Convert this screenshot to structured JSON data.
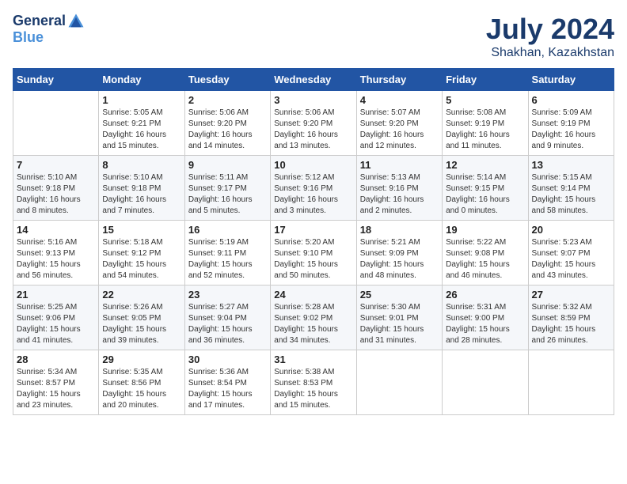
{
  "header": {
    "logo_line1": "General",
    "logo_line2": "Blue",
    "month": "July 2024",
    "location": "Shakhan, Kazakhstan"
  },
  "weekdays": [
    "Sunday",
    "Monday",
    "Tuesday",
    "Wednesday",
    "Thursday",
    "Friday",
    "Saturday"
  ],
  "weeks": [
    [
      {
        "day": "",
        "sunrise": "",
        "sunset": "",
        "daylight": ""
      },
      {
        "day": "1",
        "sunrise": "Sunrise: 5:05 AM",
        "sunset": "Sunset: 9:21 PM",
        "daylight": "Daylight: 16 hours and 15 minutes."
      },
      {
        "day": "2",
        "sunrise": "Sunrise: 5:06 AM",
        "sunset": "Sunset: 9:20 PM",
        "daylight": "Daylight: 16 hours and 14 minutes."
      },
      {
        "day": "3",
        "sunrise": "Sunrise: 5:06 AM",
        "sunset": "Sunset: 9:20 PM",
        "daylight": "Daylight: 16 hours and 13 minutes."
      },
      {
        "day": "4",
        "sunrise": "Sunrise: 5:07 AM",
        "sunset": "Sunset: 9:20 PM",
        "daylight": "Daylight: 16 hours and 12 minutes."
      },
      {
        "day": "5",
        "sunrise": "Sunrise: 5:08 AM",
        "sunset": "Sunset: 9:19 PM",
        "daylight": "Daylight: 16 hours and 11 minutes."
      },
      {
        "day": "6",
        "sunrise": "Sunrise: 5:09 AM",
        "sunset": "Sunset: 9:19 PM",
        "daylight": "Daylight: 16 hours and 9 minutes."
      }
    ],
    [
      {
        "day": "7",
        "sunrise": "Sunrise: 5:10 AM",
        "sunset": "Sunset: 9:18 PM",
        "daylight": "Daylight: 16 hours and 8 minutes."
      },
      {
        "day": "8",
        "sunrise": "Sunrise: 5:10 AM",
        "sunset": "Sunset: 9:18 PM",
        "daylight": "Daylight: 16 hours and 7 minutes."
      },
      {
        "day": "9",
        "sunrise": "Sunrise: 5:11 AM",
        "sunset": "Sunset: 9:17 PM",
        "daylight": "Daylight: 16 hours and 5 minutes."
      },
      {
        "day": "10",
        "sunrise": "Sunrise: 5:12 AM",
        "sunset": "Sunset: 9:16 PM",
        "daylight": "Daylight: 16 hours and 3 minutes."
      },
      {
        "day": "11",
        "sunrise": "Sunrise: 5:13 AM",
        "sunset": "Sunset: 9:16 PM",
        "daylight": "Daylight: 16 hours and 2 minutes."
      },
      {
        "day": "12",
        "sunrise": "Sunrise: 5:14 AM",
        "sunset": "Sunset: 9:15 PM",
        "daylight": "Daylight: 16 hours and 0 minutes."
      },
      {
        "day": "13",
        "sunrise": "Sunrise: 5:15 AM",
        "sunset": "Sunset: 9:14 PM",
        "daylight": "Daylight: 15 hours and 58 minutes."
      }
    ],
    [
      {
        "day": "14",
        "sunrise": "Sunrise: 5:16 AM",
        "sunset": "Sunset: 9:13 PM",
        "daylight": "Daylight: 15 hours and 56 minutes."
      },
      {
        "day": "15",
        "sunrise": "Sunrise: 5:18 AM",
        "sunset": "Sunset: 9:12 PM",
        "daylight": "Daylight: 15 hours and 54 minutes."
      },
      {
        "day": "16",
        "sunrise": "Sunrise: 5:19 AM",
        "sunset": "Sunset: 9:11 PM",
        "daylight": "Daylight: 15 hours and 52 minutes."
      },
      {
        "day": "17",
        "sunrise": "Sunrise: 5:20 AM",
        "sunset": "Sunset: 9:10 PM",
        "daylight": "Daylight: 15 hours and 50 minutes."
      },
      {
        "day": "18",
        "sunrise": "Sunrise: 5:21 AM",
        "sunset": "Sunset: 9:09 PM",
        "daylight": "Daylight: 15 hours and 48 minutes."
      },
      {
        "day": "19",
        "sunrise": "Sunrise: 5:22 AM",
        "sunset": "Sunset: 9:08 PM",
        "daylight": "Daylight: 15 hours and 46 minutes."
      },
      {
        "day": "20",
        "sunrise": "Sunrise: 5:23 AM",
        "sunset": "Sunset: 9:07 PM",
        "daylight": "Daylight: 15 hours and 43 minutes."
      }
    ],
    [
      {
        "day": "21",
        "sunrise": "Sunrise: 5:25 AM",
        "sunset": "Sunset: 9:06 PM",
        "daylight": "Daylight: 15 hours and 41 minutes."
      },
      {
        "day": "22",
        "sunrise": "Sunrise: 5:26 AM",
        "sunset": "Sunset: 9:05 PM",
        "daylight": "Daylight: 15 hours and 39 minutes."
      },
      {
        "day": "23",
        "sunrise": "Sunrise: 5:27 AM",
        "sunset": "Sunset: 9:04 PM",
        "daylight": "Daylight: 15 hours and 36 minutes."
      },
      {
        "day": "24",
        "sunrise": "Sunrise: 5:28 AM",
        "sunset": "Sunset: 9:02 PM",
        "daylight": "Daylight: 15 hours and 34 minutes."
      },
      {
        "day": "25",
        "sunrise": "Sunrise: 5:30 AM",
        "sunset": "Sunset: 9:01 PM",
        "daylight": "Daylight: 15 hours and 31 minutes."
      },
      {
        "day": "26",
        "sunrise": "Sunrise: 5:31 AM",
        "sunset": "Sunset: 9:00 PM",
        "daylight": "Daylight: 15 hours and 28 minutes."
      },
      {
        "day": "27",
        "sunrise": "Sunrise: 5:32 AM",
        "sunset": "Sunset: 8:59 PM",
        "daylight": "Daylight: 15 hours and 26 minutes."
      }
    ],
    [
      {
        "day": "28",
        "sunrise": "Sunrise: 5:34 AM",
        "sunset": "Sunset: 8:57 PM",
        "daylight": "Daylight: 15 hours and 23 minutes."
      },
      {
        "day": "29",
        "sunrise": "Sunrise: 5:35 AM",
        "sunset": "Sunset: 8:56 PM",
        "daylight": "Daylight: 15 hours and 20 minutes."
      },
      {
        "day": "30",
        "sunrise": "Sunrise: 5:36 AM",
        "sunset": "Sunset: 8:54 PM",
        "daylight": "Daylight: 15 hours and 17 minutes."
      },
      {
        "day": "31",
        "sunrise": "Sunrise: 5:38 AM",
        "sunset": "Sunset: 8:53 PM",
        "daylight": "Daylight: 15 hours and 15 minutes."
      },
      {
        "day": "",
        "sunrise": "",
        "sunset": "",
        "daylight": ""
      },
      {
        "day": "",
        "sunrise": "",
        "sunset": "",
        "daylight": ""
      },
      {
        "day": "",
        "sunrise": "",
        "sunset": "",
        "daylight": ""
      }
    ]
  ]
}
